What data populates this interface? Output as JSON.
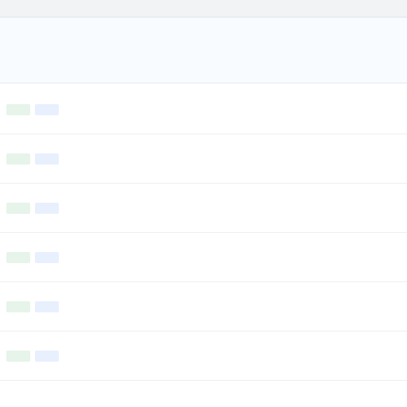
{
  "topbar": {
    "breadcrumb": ""
  },
  "header": {
    "title": "",
    "subtitle": "",
    "meta": ""
  },
  "entries": [
    {
      "title": "",
      "tags": [
        "",
        ""
      ],
      "body": [
        "",
        ""
      ]
    },
    {
      "title": "",
      "tags": [
        "",
        ""
      ],
      "body": [
        "",
        ""
      ]
    },
    {
      "title": "",
      "tags": [
        "",
        ""
      ],
      "body": [
        "",
        ""
      ]
    },
    {
      "title": "",
      "tags": [
        "",
        ""
      ],
      "body": [
        "",
        ""
      ]
    },
    {
      "title": "",
      "tags": [
        "",
        ""
      ],
      "body": [
        "",
        ""
      ]
    },
    {
      "title": "",
      "tags": [
        "",
        ""
      ],
      "body": [
        "",
        ""
      ]
    }
  ],
  "colors": {
    "link": "#1a73e8",
    "tag_green": "#188038",
    "tag_blue": "#1967d2",
    "header_bg": "#f8fbff"
  }
}
